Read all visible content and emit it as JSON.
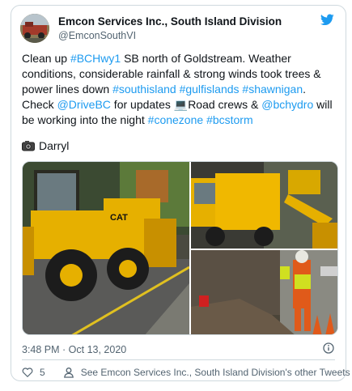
{
  "author": {
    "name": "Emcon Services Inc., South Island Division",
    "handle": "@EmconSouthVI"
  },
  "tweet": {
    "segments": [
      {
        "text": "Clean up ",
        "link": false
      },
      {
        "text": "#BCHwy1",
        "link": true
      },
      {
        "text": " SB north of Goldstream.  Weather conditions, considerable rainfall & strong winds took trees & power lines down ",
        "link": false
      },
      {
        "text": "#southisland",
        "link": true
      },
      {
        "text": " ",
        "link": false
      },
      {
        "text": "#gulfislands",
        "link": true
      },
      {
        "text": " ",
        "link": false
      },
      {
        "text": "#shawnigan",
        "link": true
      },
      {
        "text": ". Check ",
        "link": false
      },
      {
        "text": "@DriveBC",
        "link": true
      },
      {
        "text": " for updates ",
        "link": false
      },
      {
        "text": "💻",
        "link": false
      },
      {
        "text": "Road crews & ",
        "link": false
      },
      {
        "text": "@bchydro",
        "link": true
      },
      {
        "text": " will be working into the night ",
        "link": false
      },
      {
        "text": "#conezone",
        "link": true
      },
      {
        "text": " ",
        "link": false
      },
      {
        "text": "#bcstorm",
        "link": true
      }
    ],
    "credit": "Darryl"
  },
  "meta": {
    "timestamp": "3:48 PM · Oct 13, 2020"
  },
  "actions": {
    "like_count": "5",
    "others_label": "See Emcon Services Inc., South Island Division's other Tweets"
  },
  "icons": {
    "brand": "twitter-bird-icon",
    "camera": "camera-icon",
    "info": "info-icon",
    "like": "heart-icon",
    "profile": "person-icon"
  },
  "colors": {
    "link": "#1d9bf0",
    "brand": "#1d9bf0",
    "secondary_text": "#536471",
    "border": "#cfd9de",
    "loader_yellow": "#e6b000"
  }
}
